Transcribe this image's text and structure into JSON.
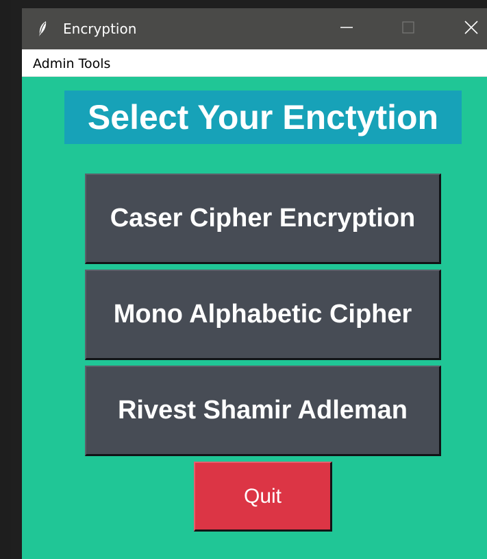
{
  "window": {
    "title": "Encryption",
    "icon": "feather-icon",
    "controls": {
      "minimize_icon": "minimize-icon",
      "maximize_icon": "maximize-icon",
      "close_icon": "close-icon"
    }
  },
  "menubar": {
    "items": [
      {
        "label": "Admin Tools"
      }
    ]
  },
  "main": {
    "heading": "Select Your Enctytion",
    "buttons": [
      {
        "label": "Caser Cipher Encryption"
      },
      {
        "label": "Mono Alphabetic Cipher"
      },
      {
        "label": "Rivest Shamir Adleman"
      }
    ],
    "quit_label": "Quit"
  },
  "colors": {
    "background": "#20c696",
    "heading_background": "#17a2b8",
    "button_background": "#474c55",
    "quit_background": "#dc3545",
    "titlebar": "#4a4a48"
  }
}
